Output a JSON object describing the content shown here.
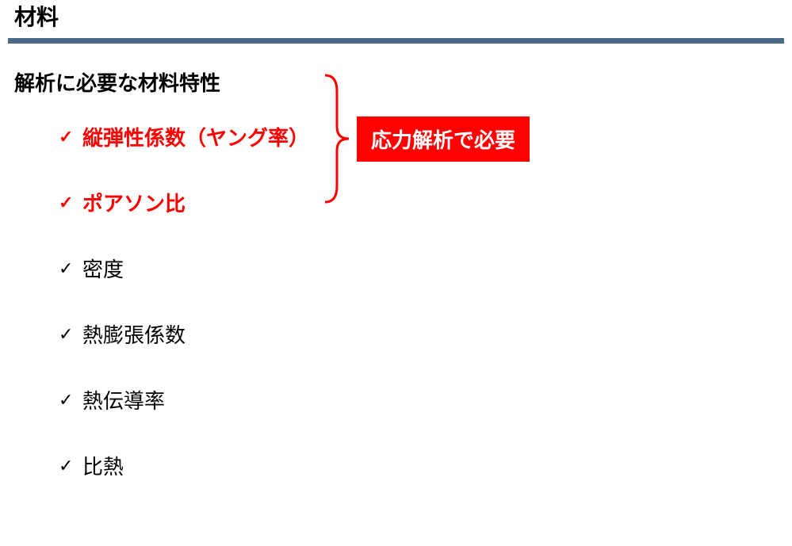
{
  "header": {
    "title": "材料"
  },
  "subtitle": "解析に必要な材料特性",
  "items": [
    {
      "label": "縦弾性係数（ヤング率）",
      "highlight": true
    },
    {
      "label": "ポアソン比",
      "highlight": true
    },
    {
      "label": "密度",
      "highlight": false
    },
    {
      "label": "熱膨張係数",
      "highlight": false
    },
    {
      "label": "熱伝導率",
      "highlight": false
    },
    {
      "label": "比熱",
      "highlight": false
    }
  ],
  "callout": {
    "label": "応力解析で必要"
  }
}
